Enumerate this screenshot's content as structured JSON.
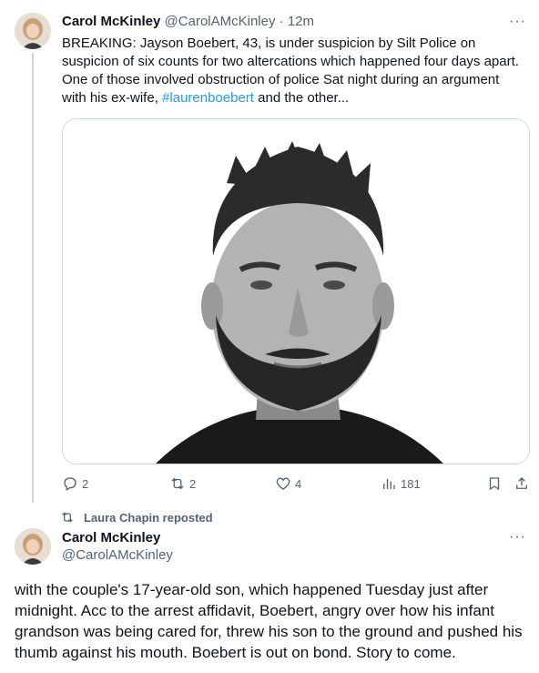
{
  "tweet": {
    "author_name": "Carol McKinley",
    "author_handle": "@CarolAMcKinley",
    "separator": "·",
    "time": "12m",
    "more": "···",
    "text_before_hashtag": "BREAKING: Jayson Boebert, 43, is under suspicion by Silt Police on suspicion of six counts for two altercations which happened four days apart. One of those involved obstruction of police Sat night during an argument with his ex-wife, ",
    "hashtag": "#laurenboebert",
    "text_after_hashtag": " and the other...",
    "media_description": "mugshot-photo",
    "actions": {
      "replies": "2",
      "reposts": "2",
      "likes": "4",
      "views": "181"
    }
  },
  "repost_banner": {
    "text": "Laura Chapin reposted"
  },
  "reply_tweet": {
    "author_name": "Carol McKinley",
    "author_handle": "@CarolAMcKinley",
    "more": "···",
    "text": "with the couple's 17-year-old son, which happened Tuesday just after midnight. Acc to the arrest affidavit, Boebert, angry over how his infant grandson was being cared for, threw his son to the ground and pushed his thumb against his mouth. Boebert is out on bond. Story to come."
  },
  "colors": {
    "link": "#1d9bf0",
    "secondary_text": "#536471",
    "primary_text": "#0f1419",
    "border": "#cfd9de"
  },
  "icons": [
    "reply-icon",
    "repost-icon",
    "like-icon",
    "views-icon",
    "bookmark-icon",
    "share-icon",
    "more-icon"
  ]
}
